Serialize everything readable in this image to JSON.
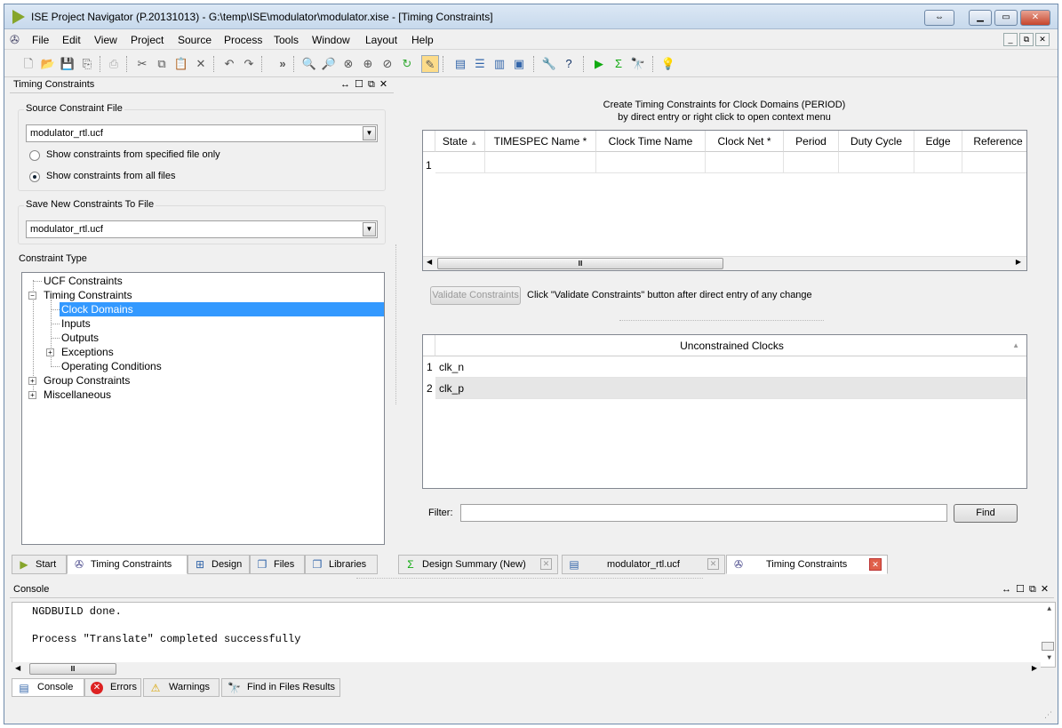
{
  "window": {
    "title": "ISE Project Navigator (P.20131013) - G:\\temp\\ISE\\modulator\\modulator.xise - [Timing Constraints]"
  },
  "menu": [
    "File",
    "Edit",
    "View",
    "Project",
    "Source",
    "Process",
    "Tools",
    "Window",
    "Layout",
    "Help"
  ],
  "left_panel": {
    "title": "Timing Constraints",
    "controls": "↔ ☐ ⧉ ✕",
    "source_group": "Source Constraint File",
    "source_file": "modulator_rtl.ucf",
    "radio1": "Show constraints from specified file only",
    "radio2": "Show constraints from all files",
    "save_group": "Save New Constraints To File",
    "save_file": "modulator_rtl.ucf",
    "constraint_type": "Constraint Type",
    "tree": {
      "ucf": "UCF Constraints",
      "timing": "Timing Constraints",
      "clock_domains": "Clock Domains",
      "inputs": "Inputs",
      "outputs": "Outputs",
      "exceptions": "Exceptions",
      "operating": "Operating Conditions",
      "group": "Group Constraints",
      "misc": "Miscellaneous"
    }
  },
  "right_panel": {
    "heading1": "Create Timing Constraints for Clock Domains (PERIOD)",
    "heading2": "by direct entry or right click to open context menu",
    "columns": [
      "State",
      "TIMESPEC Name *",
      "Clock Time Name",
      "Clock Net *",
      "Period",
      "Duty Cycle",
      "Edge",
      "Reference"
    ],
    "row1": "1",
    "validate_button": "Validate Constraints",
    "validate_hint": "Click \"Validate Constraints\" button after direct entry of any change",
    "unconstrained_header": "Unconstrained Clocks",
    "clocks": [
      {
        "n": "1",
        "name": "clk_n"
      },
      {
        "n": "2",
        "name": "clk_p"
      }
    ],
    "filter_label": "Filter:",
    "filter_value": "",
    "find_button": "Find"
  },
  "left_tabs": [
    "Start",
    "Timing Constraints",
    "Design",
    "Files",
    "Libraries"
  ],
  "doc_tabs": [
    "Design Summary (New)",
    "modulator_rtl.ucf",
    "Timing Constraints"
  ],
  "console": {
    "title": "Console",
    "lines": [
      "NGDBUILD done.",
      "",
      "Process \"Translate\" completed successfully"
    ]
  },
  "bottom_tabs": [
    "Console",
    "Errors",
    "Warnings",
    "Find in Files Results"
  ],
  "colors": {
    "selection": "#3399ff",
    "close": "#c6452c",
    "accent": "#86a52b"
  }
}
